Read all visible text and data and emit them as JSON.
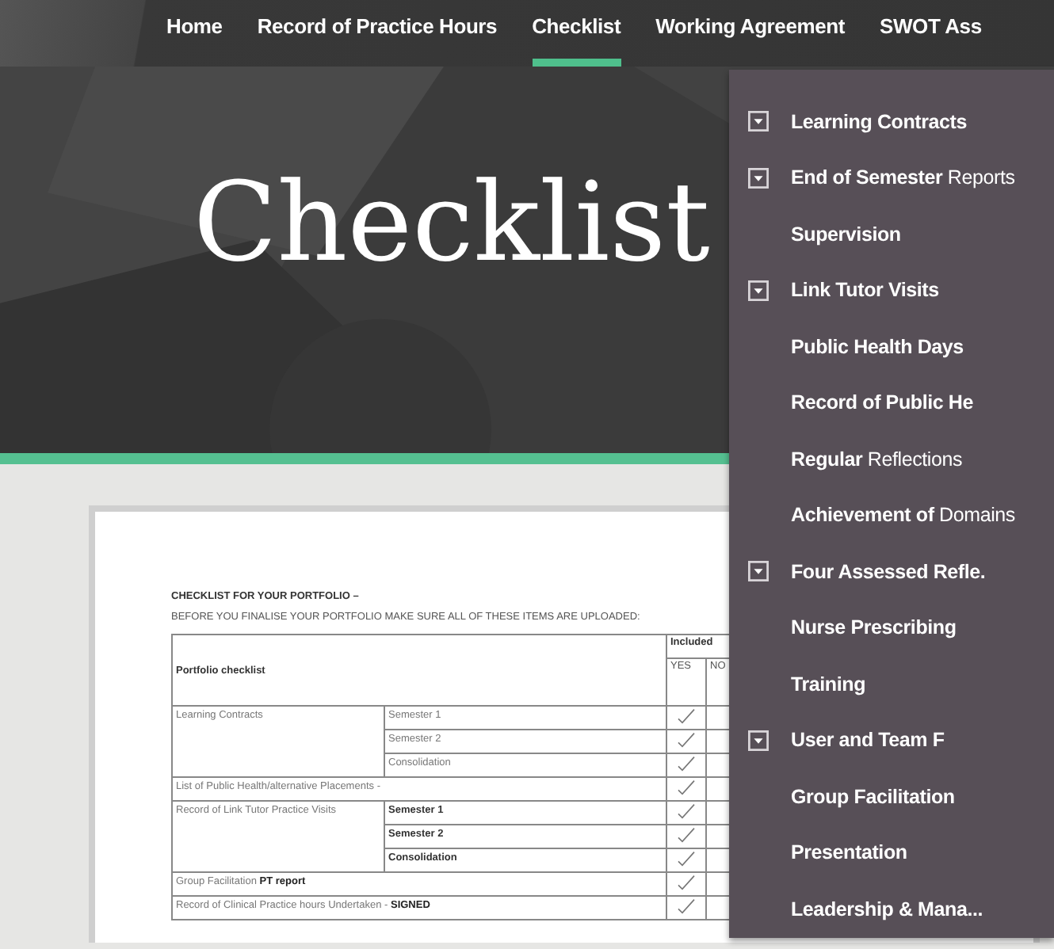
{
  "nav": {
    "items": [
      {
        "label": "Home",
        "selected": false
      },
      {
        "label": "Record of Practice Hours",
        "selected": false
      },
      {
        "label": "Checklist",
        "selected": true
      },
      {
        "label": "Working Agreement",
        "selected": false
      },
      {
        "label": "SWOT Ass",
        "selected": false
      }
    ]
  },
  "hero": {
    "title": "Checklist"
  },
  "document": {
    "heading": "CHECKLIST FOR YOUR PORTFOLIO –",
    "instruction": "BEFORE YOU FINALISE YOUR PORTFOLIO MAKE SURE ALL OF THESE ITEMS ARE UPLOADED:",
    "table": {
      "header": "Portfolio checklist",
      "included_header": "Included",
      "yes_header": "YES",
      "no_header": "NO",
      "groups": [
        {
          "label": "Learning Contracts",
          "items": [
            {
              "text": "Semester 1",
              "emphasis": false,
              "included": true
            },
            {
              "text": "Semester 2",
              "emphasis": false,
              "included": true
            },
            {
              "text": "Consolidation",
              "emphasis": false,
              "included": true
            }
          ]
        },
        {
          "label": "List of  Public Health/alternative Placements -",
          "included": true
        },
        {
          "label": "Record of Link Tutor Practice Visits",
          "items": [
            {
              "text": "Semester 1",
              "emphasis": true,
              "included": true
            },
            {
              "text": "Semester 2",
              "emphasis": true,
              "included": true
            },
            {
              "text": "Consolidation",
              "emphasis": true,
              "included": true
            }
          ]
        },
        {
          "label": "Group Facilitation  **PT report**",
          "included": true
        },
        {
          "label": "Record of Clinical Practice hours Undertaken -   **SIGNED**",
          "included": true
        }
      ]
    }
  },
  "menu": {
    "items": [
      {
        "label": "Learning Contracts",
        "expandable": true
      },
      {
        "label": "**End of Semester** Reports",
        "expandable": true
      },
      {
        "label": "Supervision",
        "expandable": false
      },
      {
        "label": "Link Tutor Visits",
        "expandable": true
      },
      {
        "label": "Public Health Days",
        "expandable": false
      },
      {
        "label": "Record of Public He",
        "expandable": false
      },
      {
        "label": "**Regular** Reflections",
        "expandable": false
      },
      {
        "label": "**Achievement of** Domains",
        "expandable": false
      },
      {
        "label": "Four Assessed Refle.",
        "expandable": true
      },
      {
        "label": "Nurse Prescribing",
        "expandable": false
      },
      {
        "label": "Training",
        "expandable": false
      },
      {
        "label": "User and Team F",
        "expandable": true
      },
      {
        "label": "Group Facilitation",
        "expandable": false
      },
      {
        "label": "Presentation",
        "expandable": false
      },
      {
        "label": "Leadership & Mana...",
        "expandable": false
      }
    ]
  }
}
